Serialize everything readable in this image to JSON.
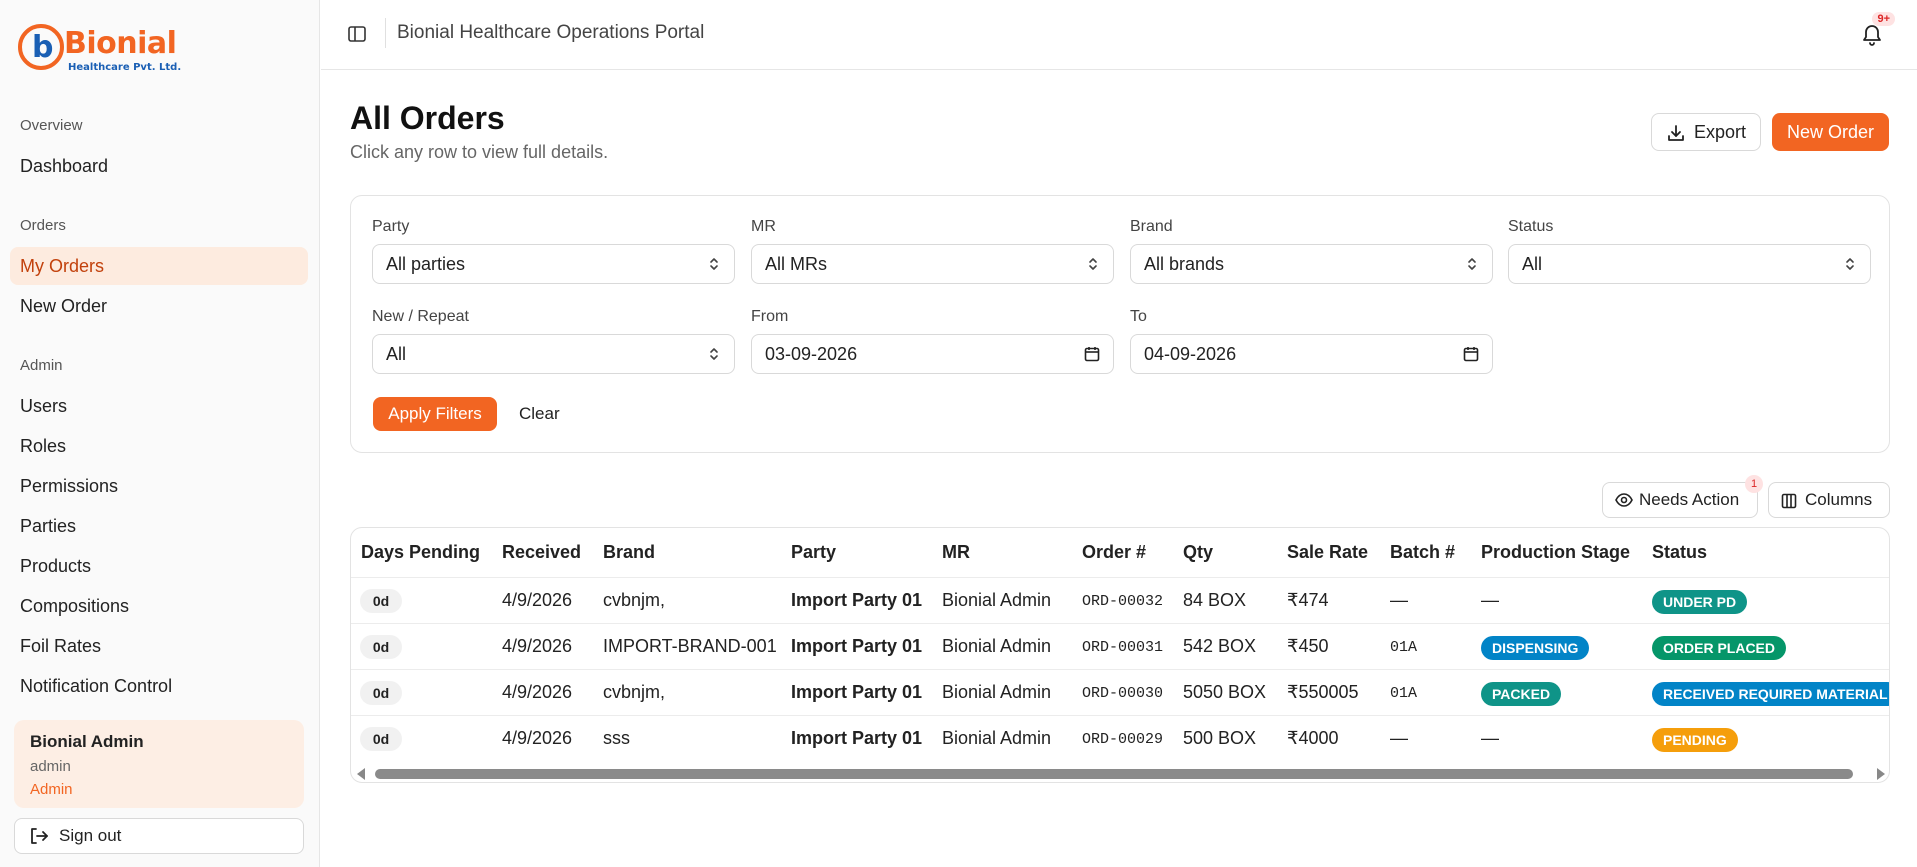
{
  "brand": {
    "name": "Bionial",
    "tagline": "Healthcare Pvt. Ltd.",
    "accent_color": "#f26522",
    "secondary_color": "#1a5fb4"
  },
  "sidebar": {
    "groups": [
      {
        "label": "Overview",
        "items": [
          {
            "label": "Dashboard",
            "active": false
          }
        ]
      },
      {
        "label": "Orders",
        "items": [
          {
            "label": "My Orders",
            "active": true
          },
          {
            "label": "New Order",
            "active": false
          }
        ]
      },
      {
        "label": "Admin",
        "items": [
          {
            "label": "Users",
            "active": false
          },
          {
            "label": "Roles",
            "active": false
          },
          {
            "label": "Permissions",
            "active": false
          },
          {
            "label": "Parties",
            "active": false
          },
          {
            "label": "Products",
            "active": false
          },
          {
            "label": "Compositions",
            "active": false
          },
          {
            "label": "Foil Rates",
            "active": false
          },
          {
            "label": "Notification Control",
            "active": false
          }
        ]
      }
    ],
    "user": {
      "name": "Bionial Admin",
      "login": "admin",
      "role": "Admin"
    },
    "signout_label": "Sign out"
  },
  "topbar": {
    "title": "Bionial Healthcare Operations Portal",
    "toggle_icon": "sidebar-toggle-icon",
    "notification_icon": "bell-icon",
    "notification_count": "9+"
  },
  "page": {
    "title": "All Orders",
    "subtitle": "Click any row to view full details.",
    "export_label": "Export",
    "new_order_label": "New Order"
  },
  "filters": {
    "party": {
      "label": "Party",
      "value": "All parties"
    },
    "mr": {
      "label": "MR",
      "value": "All MRs"
    },
    "brand": {
      "label": "Brand",
      "value": "All brands"
    },
    "status": {
      "label": "Status",
      "value": "All"
    },
    "new_repeat": {
      "label": "New / Repeat",
      "value": "All"
    },
    "from": {
      "label": "From",
      "value": "03-09-2026"
    },
    "to": {
      "label": "To",
      "value": "04-09-2026"
    },
    "apply_label": "Apply Filters",
    "clear_label": "Clear"
  },
  "table_tools": {
    "needs_action_label": "Needs Action",
    "needs_action_count": "1",
    "columns_label": "Columns"
  },
  "table": {
    "columns": [
      "Days Pending",
      "Received",
      "Brand",
      "Party",
      "MR",
      "Order #",
      "Qty",
      "Sale Rate",
      "Batch #",
      "Production Stage",
      "Status"
    ],
    "rows": [
      {
        "days": "0d",
        "received": "4/9/2026",
        "brand": "cvbnjm,",
        "party": "Import Party 01",
        "mr": "Bionial Admin",
        "order": "ORD-00032",
        "qty": "84 BOX",
        "rate": "₹474",
        "batch": "—",
        "stage": "—",
        "stage_color": "",
        "status": "UNDER PD",
        "status_color": "#0f9488"
      },
      {
        "days": "0d",
        "received": "4/9/2026",
        "brand": "IMPORT-BRAND-001",
        "party": "Import Party 01",
        "mr": "Bionial Admin",
        "order": "ORD-00031",
        "qty": "542 BOX",
        "rate": "₹450",
        "batch": "01A",
        "stage": "DISPENSING",
        "stage_color": "#0284c7",
        "status": "ORDER PLACED",
        "status_color": "#059669"
      },
      {
        "days": "0d",
        "received": "4/9/2026",
        "brand": "cvbnjm,",
        "party": "Import Party 01",
        "mr": "Bionial Admin",
        "order": "ORD-00030",
        "qty": "5050 BOX",
        "rate": "₹550005",
        "batch": "01A",
        "stage": "PACKED",
        "stage_color": "#0f9488",
        "status": "RECEIVED REQUIRED MATERIAL",
        "status_color": "#0284c7"
      },
      {
        "days": "0d",
        "received": "4/9/2026",
        "brand": "sss",
        "party": "Import Party 01",
        "mr": "Bionial Admin",
        "order": "ORD-00029",
        "qty": "500 BOX",
        "rate": "₹4000",
        "batch": "—",
        "stage": "—",
        "stage_color": "",
        "status": "PENDING",
        "status_color": "#f59e0b"
      }
    ]
  }
}
